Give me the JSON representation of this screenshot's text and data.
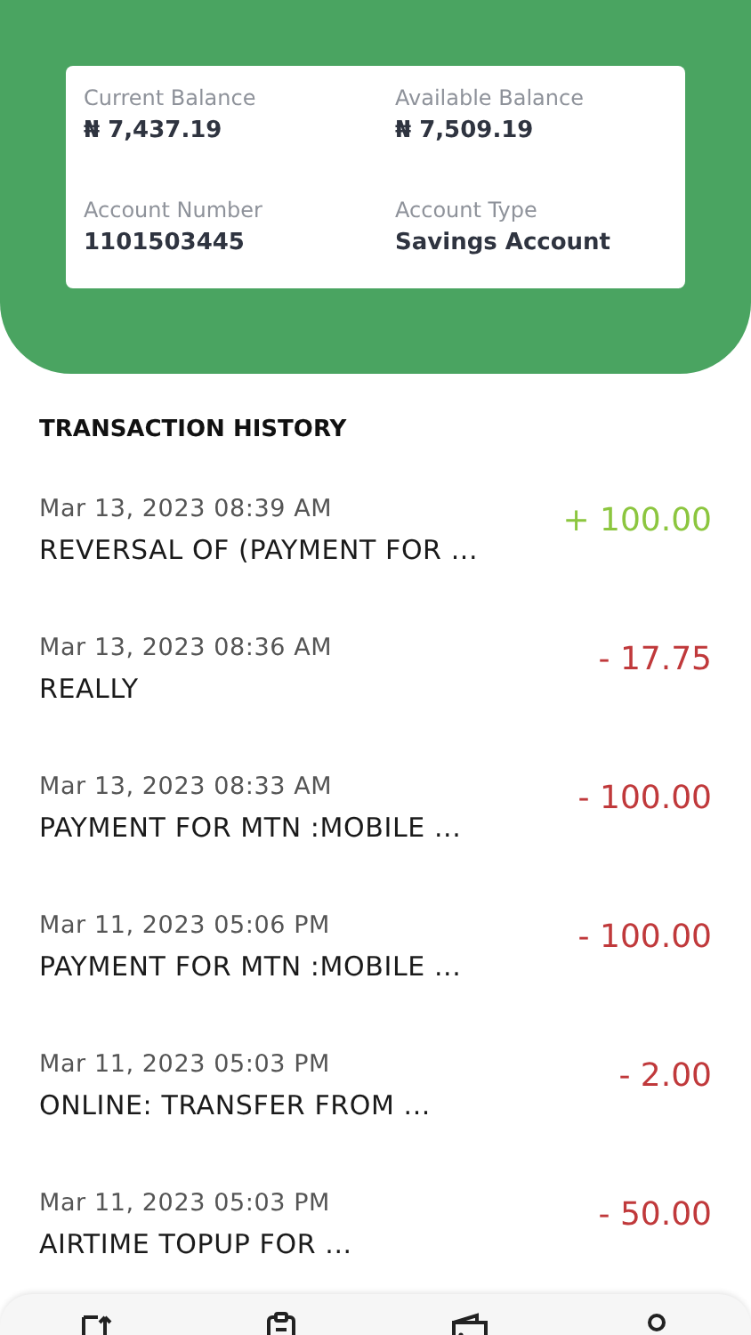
{
  "account_card": {
    "fields": [
      {
        "label": "Current Balance",
        "value": "₦ 7,437.19"
      },
      {
        "label": "Available Balance",
        "value": "₦ 7,509.19"
      },
      {
        "label": "Account Number",
        "value": "1101503445"
      },
      {
        "label": "Account Type",
        "value": "Savings Account"
      }
    ]
  },
  "section_title": "TRANSACTION HISTORY",
  "transactions": [
    {
      "date": "Mar 13, 2023 08:39 AM",
      "description": "REVERSAL OF (PAYMENT FOR ...",
      "amount": "+ 100.00",
      "kind": "credit"
    },
    {
      "date": "Mar 13, 2023 08:36 AM",
      "description": "REALLY",
      "amount": "- 17.75",
      "kind": "debit"
    },
    {
      "date": "Mar 13, 2023 08:33 AM",
      "description": "PAYMENT FOR MTN :MOBILE ...",
      "amount": "- 100.00",
      "kind": "debit"
    },
    {
      "date": "Mar 11, 2023 05:06 PM",
      "description": "PAYMENT FOR MTN :MOBILE ...",
      "amount": "- 100.00",
      "kind": "debit"
    },
    {
      "date": "Mar 11, 2023 05:03 PM",
      "description": "ONLINE: TRANSFER FROM ...",
      "amount": "- 2.00",
      "kind": "debit"
    },
    {
      "date": "Mar 11, 2023 05:03 PM",
      "description": "AIRTIME TOPUP FOR ...",
      "amount": "- 50.00",
      "kind": "debit"
    }
  ]
}
